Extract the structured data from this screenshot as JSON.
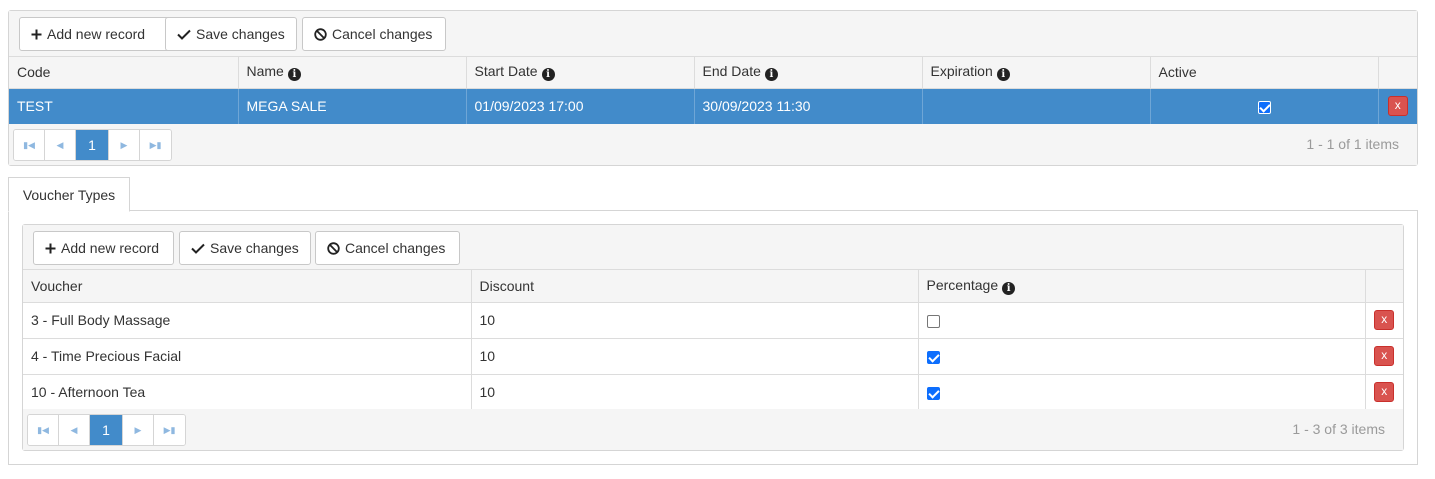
{
  "main_grid": {
    "toolbar": {
      "add_label": "Add new record",
      "save_label": "Save changes",
      "cancel_label": "Cancel changes"
    },
    "columns": [
      "Code",
      "Name",
      "Start Date",
      "End Date",
      "Expiration",
      "Active"
    ],
    "rows": [
      {
        "code": "TEST",
        "name": "MEGA SALE",
        "start_date": "01/09/2023 17:00",
        "end_date": "30/09/2023 11:30",
        "expiration": "",
        "active": true,
        "delete_label": "x"
      }
    ],
    "pager": {
      "current_page": "1",
      "info": "1 - 1 of 1 items"
    }
  },
  "tabs": [
    {
      "label": "Voucher Types",
      "active": true
    }
  ],
  "voucher_grid": {
    "toolbar": {
      "add_label": "Add new record",
      "save_label": "Save changes",
      "cancel_label": "Cancel changes"
    },
    "columns": [
      "Voucher",
      "Discount",
      "Percentage"
    ],
    "rows": [
      {
        "voucher": "3 - Full Body Massage",
        "discount": "10",
        "percentage": false,
        "delete_label": "x"
      },
      {
        "voucher": "4 - Time Precious Facial",
        "discount": "10",
        "percentage": true,
        "delete_label": "x"
      },
      {
        "voucher": "10 - Afternoon Tea",
        "discount": "10",
        "percentage": true,
        "delete_label": "x"
      }
    ],
    "pager": {
      "current_page": "1",
      "info": "1 - 3 of 3 items"
    }
  },
  "colors": {
    "selected_row": "#428bca",
    "delete_button": "#d9534f",
    "checkbox_checked": "#0d6efd"
  },
  "icons": {
    "add": "plus-icon",
    "save": "check-icon",
    "cancel": "ban-icon",
    "info": "info-circle-icon",
    "first": "first-page-icon",
    "prev": "prev-page-icon",
    "next": "next-page-icon",
    "last": "last-page-icon"
  }
}
